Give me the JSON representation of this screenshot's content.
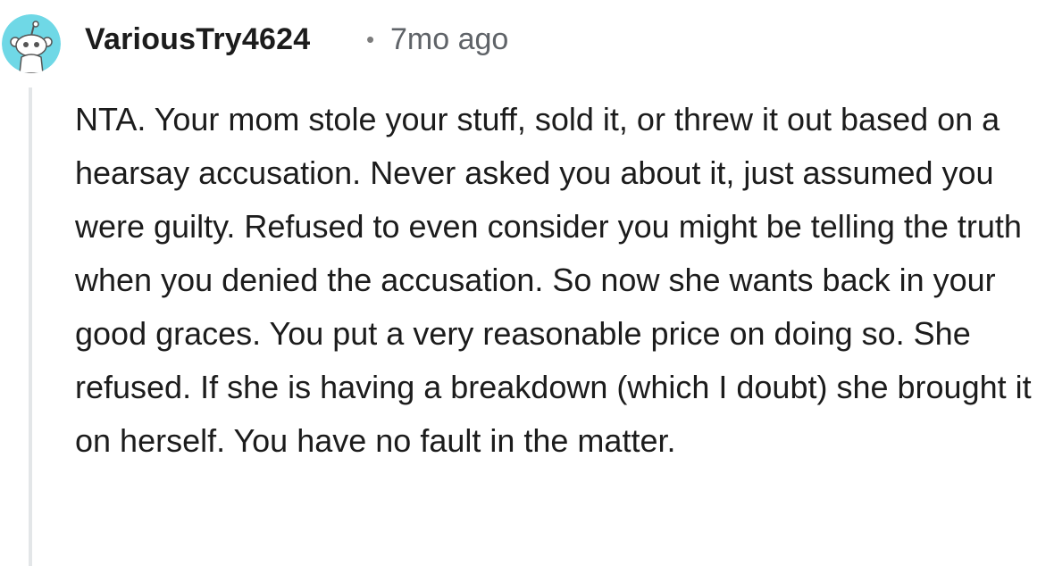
{
  "comment": {
    "author": "VariousTry4624",
    "separator": "•",
    "timestamp": "7mo ago",
    "avatar_icon": "reddit-snoo-avatar-icon",
    "colors": {
      "avatar_bg": "#6fd8e6",
      "thread_line": "#e3e6e8",
      "text": "#1c1c1c",
      "meta": "#5f6368"
    },
    "body": "NTA. Your mom stole your stuff, sold it, or threw it out based on a hearsay accusation. Never asked you about it, just assumed you were guilty. Refused to even consider you might be telling the truth when you denied the accusation. So now she wants back in your good graces. You put a very reasonable price on doing so. She refused. If she is having a breakdown (which I doubt) she brought it on herself. You have no fault in the matter."
  }
}
